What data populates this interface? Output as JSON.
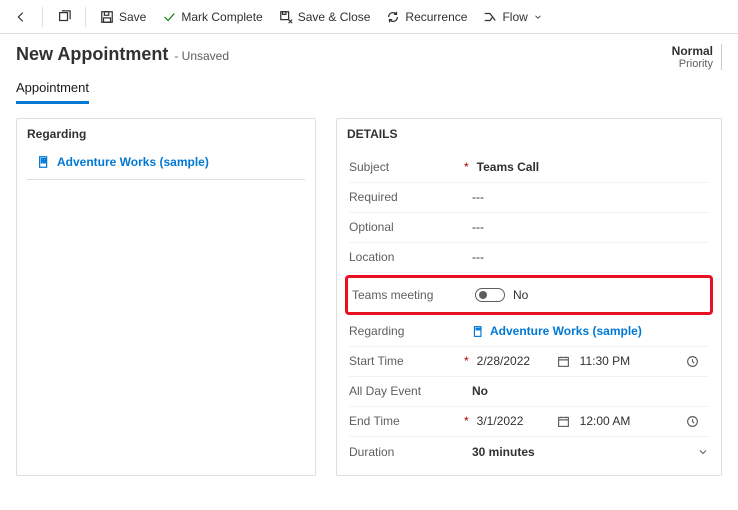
{
  "toolbar": {
    "save": "Save",
    "markComplete": "Mark Complete",
    "saveClose": "Save & Close",
    "recurrence": "Recurrence",
    "flow": "Flow"
  },
  "header": {
    "title": "New Appointment",
    "unsaved": "- Unsaved",
    "priorityValue": "Normal",
    "priorityLabel": "Priority"
  },
  "tab": {
    "appointment": "Appointment"
  },
  "regarding": {
    "title": "Regarding",
    "linkText": "Adventure Works (sample)"
  },
  "details": {
    "title": "DETAILS",
    "labels": {
      "subject": "Subject",
      "required": "Required",
      "optional": "Optional",
      "location": "Location",
      "teamsMeeting": "Teams meeting",
      "regarding": "Regarding",
      "startTime": "Start Time",
      "allDay": "All Day Event",
      "endTime": "End Time",
      "duration": "Duration"
    },
    "values": {
      "subject": "Teams Call",
      "required": "---",
      "optional": "---",
      "location": "---",
      "teamsMeeting": "No",
      "regarding": "Adventure Works (sample)",
      "startDate": "2/28/2022",
      "startTime": "11:30 PM",
      "allDay": "No",
      "endDate": "3/1/2022",
      "endTime": "12:00 AM",
      "duration": "30 minutes"
    },
    "requiredMarker": "*"
  }
}
